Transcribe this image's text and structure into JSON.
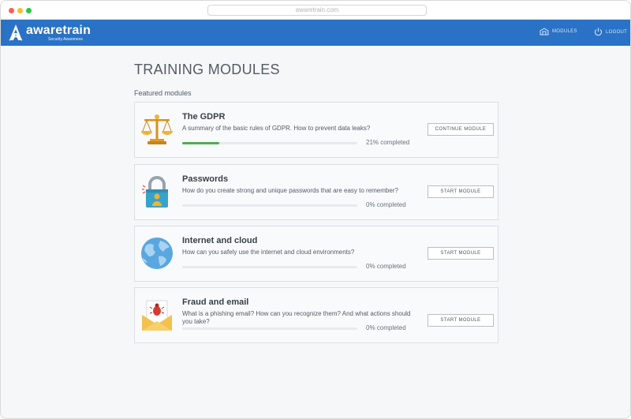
{
  "browser": {
    "url": "awaretrain.com"
  },
  "header": {
    "logo_text": "awaretrain",
    "logo_subtitle": "Security Awareness",
    "nav_modules": "MODULES",
    "nav_logout": "LOGOUT",
    "brand_color": "#2a72c5"
  },
  "main": {
    "title": "TRAINING MODULES",
    "section_label": "Featured modules"
  },
  "modules": [
    {
      "title": "The GDPR",
      "description": "A summary of the basic rules of GDPR. How to prevent data leaks?",
      "progress_text": "21% completed",
      "progress": 0.21,
      "button": "CONTINUE MODULE",
      "icon": "scales-icon"
    },
    {
      "title": "Passwords",
      "description": "How do you create strong and unique passwords that are easy to remember?",
      "progress_text": "0% completed",
      "progress": 0,
      "button": "START MODULE",
      "icon": "padlock-icon"
    },
    {
      "title": "Internet and cloud",
      "description": "How can you safely use the internet and cloud environments?",
      "progress_text": "0% completed",
      "progress": 0,
      "button": "START MODULE",
      "icon": "globe-icon"
    },
    {
      "title": "Fraud and email",
      "description": "What is a phishing email? How can you recognize them? And what actions should you take?",
      "progress_text": "0% completed",
      "progress": 0,
      "button": "START MODULE",
      "icon": "phishing-email-icon"
    }
  ]
}
